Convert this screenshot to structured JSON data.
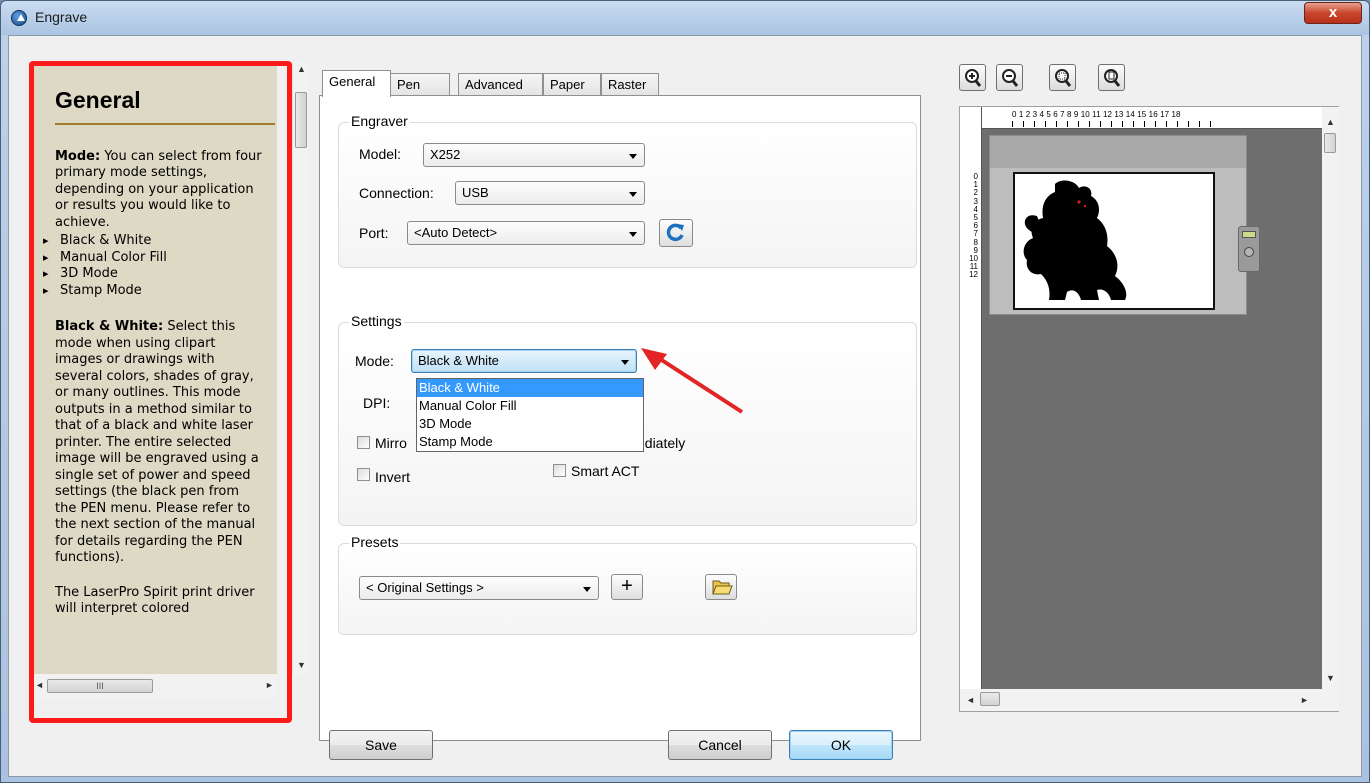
{
  "window": {
    "title": "Engrave",
    "close_label": "x"
  },
  "help": {
    "title": "General",
    "mode_heading": "Mode:",
    "mode_text": "You can select from four primary mode settings, depending on your application or results you would like to achieve.",
    "mode_list": [
      "Black & White",
      "Manual Color Fill",
      "3D Mode",
      "Stamp Mode"
    ],
    "bw_heading": "Black & White:",
    "bw_text": "Select this mode when using clipart images or drawings with several colors, shades of gray, or many outlines. This mode outputs in a method similar to that of a black and white laser printer. The entire selected image will be engraved using a single set of power and speed settings (the black pen from the PEN menu. Please refer to the next section of the manual for details regarding the PEN functions).",
    "tail_text": "The LaserPro Spirit print driver will interpret colored",
    "hscroll_grip": "III"
  },
  "tabs": [
    "General",
    "Pen",
    "Advanced",
    "Paper",
    "Raster"
  ],
  "engraver": {
    "group_label": "Engraver",
    "model_label": "Model:",
    "model_value": "X252",
    "connection_label": "Connection:",
    "connection_value": "USB",
    "port_label": "Port:",
    "port_value": "<Auto Detect>"
  },
  "settings": {
    "group_label": "Settings",
    "mode_label": "Mode:",
    "mode_value": "Black & White",
    "mode_options": [
      "Black & White",
      "Manual Color Fill",
      "3D Mode",
      "Stamp Mode"
    ],
    "dpi_label": "DPI:",
    "mirror_label": "Mirro",
    "immediately_label": "ediately",
    "invert_label": "Invert",
    "smart_act_label": "Smart ACT"
  },
  "presets": {
    "group_label": "Presets",
    "value": "< Original Settings >",
    "add_label": "+"
  },
  "buttons": {
    "save": "Save",
    "cancel": "Cancel",
    "ok": "OK"
  },
  "preview": {
    "ruler_top": "0 1 2 3 4 5 6 7 8 9 10 11 12 13 14 15 16 17 18",
    "ruler_left": [
      "0",
      "1",
      "2",
      "3",
      "4",
      "5",
      "6",
      "7",
      "8",
      "9",
      "10",
      "11",
      "12"
    ]
  },
  "colors": {
    "highlight": "#ff1a1a",
    "selection": "#3399ff"
  },
  "icons": [
    "refresh-icon",
    "folder-icon",
    "zoom-in-icon",
    "zoom-out-icon",
    "zoom-fit-icon",
    "zoom-page-icon"
  ]
}
